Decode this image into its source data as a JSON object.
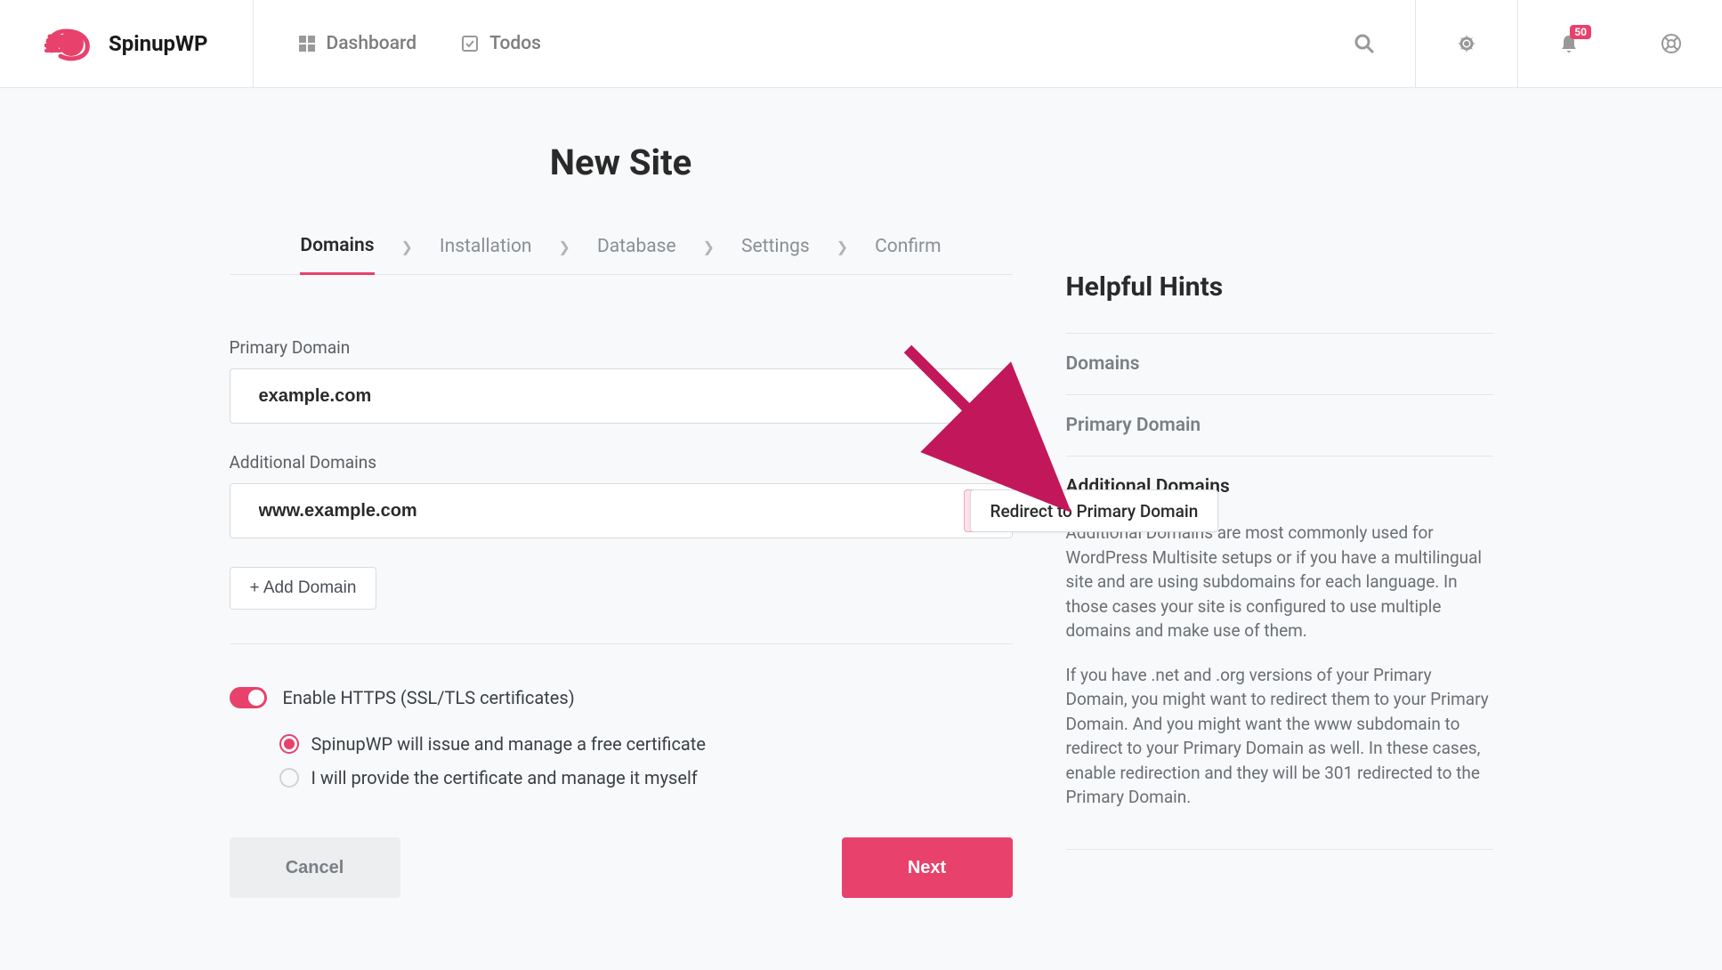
{
  "brand": "SpinupWP",
  "nav": {
    "dashboard": "Dashboard",
    "todos": "Todos"
  },
  "notifications_count": "50",
  "page_title": "New Site",
  "steps": [
    "Domains",
    "Installation",
    "Database",
    "Settings",
    "Confirm"
  ],
  "active_step_index": 0,
  "form": {
    "primary_label": "Primary Domain",
    "primary_value": "example.com",
    "additional_label": "Additional Domains",
    "additional_value": "www.example.com",
    "add_domain": "+ Add Domain",
    "redirect_tooltip": "Redirect to Primary Domain",
    "https_toggle": "Enable HTTPS (SSL/TLS certificates)",
    "radio_auto": "SpinupWP will issue and manage a free certificate",
    "radio_manual": "I will provide the certificate and manage it myself",
    "cancel": "Cancel",
    "next": "Next"
  },
  "hints": {
    "title": "Helpful Hints",
    "sect1": "Domains",
    "sect2": "Primary Domain",
    "sect3": "Additional Domains",
    "p1": "Additional Domains are most commonly used for WordPress Multisite setups or if you have a multilingual site and are using subdomains for each language. In those cases your site is configured to use multiple domains and make use of them.",
    "p2": "If you have .net and .org versions of your Primary Domain, you might want to redirect them to your Primary Domain. And you might want the www subdomain to redirect to your Primary Domain as well. In these cases, enable redirection and they will be 301 redirected to the Primary Domain."
  },
  "colors": {
    "accent": "#e8416c"
  }
}
